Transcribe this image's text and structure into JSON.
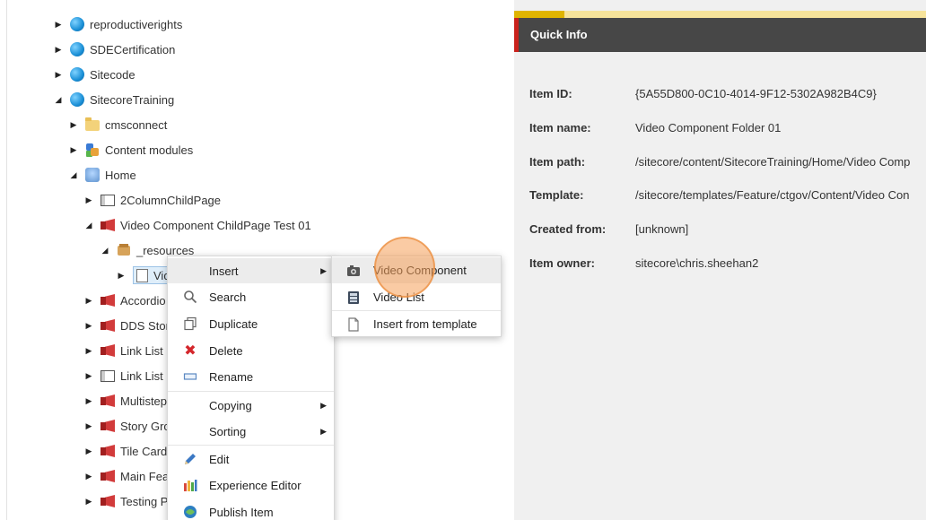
{
  "tree": {
    "items": [
      {
        "label": "reproductiverights",
        "icon": "globe-icon"
      },
      {
        "label": "SDECertification",
        "icon": "globe-icon"
      },
      {
        "label": "Sitecode",
        "icon": "globe-icon"
      },
      {
        "label": "SitecoreTraining",
        "icon": "globe-icon"
      },
      {
        "label": "cmsconnect",
        "icon": "folder-icon"
      },
      {
        "label": "Content modules",
        "icon": "modules-icon"
      },
      {
        "label": "Home",
        "icon": "home-icon"
      },
      {
        "label": "2ColumnChildPage",
        "icon": "page-icon"
      },
      {
        "label": "Video Component ChildPage Test 01",
        "icon": "red-flag-icon"
      },
      {
        "label": "_resources",
        "icon": "box-icon"
      },
      {
        "label": "Vid",
        "icon": "document-icon"
      },
      {
        "label": "Accordio",
        "icon": "red-flag-icon"
      },
      {
        "label": "DDS Stor",
        "icon": "red-flag-icon"
      },
      {
        "label": "Link List",
        "icon": "red-flag-icon"
      },
      {
        "label": "Link List",
        "icon": "page-icon"
      },
      {
        "label": "Multistep",
        "icon": "red-flag-icon"
      },
      {
        "label": "Story Gro",
        "icon": "red-flag-icon"
      },
      {
        "label": "Tile Card",
        "icon": "red-flag-icon"
      },
      {
        "label": "Main Fea",
        "icon": "red-flag-icon"
      },
      {
        "label": "Testing P",
        "icon": "red-flag-icon"
      }
    ]
  },
  "context_menu": {
    "items": [
      {
        "label": "Insert",
        "icon": "",
        "submenu": true
      },
      {
        "label": "Search",
        "icon": "search-icon",
        "submenu": false
      },
      {
        "label": "Duplicate",
        "icon": "duplicate-icon",
        "submenu": false
      },
      {
        "label": "Delete",
        "icon": "delete-icon",
        "submenu": false
      },
      {
        "label": "Rename",
        "icon": "rename-icon",
        "submenu": false
      },
      {
        "label": "Copying",
        "icon": "",
        "submenu": true
      },
      {
        "label": "Sorting",
        "icon": "",
        "submenu": true
      },
      {
        "label": "Edit",
        "icon": "pencil-icon",
        "submenu": false
      },
      {
        "label": "Experience Editor",
        "icon": "experience-editor-icon",
        "submenu": false
      },
      {
        "label": "Publish Item",
        "icon": "publish-icon",
        "submenu": false
      }
    ]
  },
  "insert_submenu": {
    "items": [
      {
        "label": "Video Component",
        "icon": "video-camera-icon"
      },
      {
        "label": "Video List",
        "icon": "video-list-icon"
      },
      {
        "label": "Insert from template",
        "icon": "document-icon"
      }
    ]
  },
  "quick_info": {
    "title": "Quick Info",
    "rows": [
      {
        "label": "Item ID:",
        "value": "{5A55D800-0C10-4014-9F12-5302A982B4C9}"
      },
      {
        "label": "Item name:",
        "value": "Video Component Folder 01"
      },
      {
        "label": "Item path:",
        "value": "/sitecore/content/SitecoreTraining/Home/Video Comp"
      },
      {
        "label": "Template:",
        "value": "/sitecore/templates/Feature/ctgov/Content/Video Con"
      },
      {
        "label": "Created from:",
        "value": "[unknown]"
      },
      {
        "label": "Item owner:",
        "value": "sitecore\\chris.sheehan2"
      }
    ]
  },
  "colors": {
    "header_bg": "#474747",
    "header_accent": "#c9221c",
    "top_accent": "#f6e39a",
    "selection": "#dfeefa",
    "click_indicator": "#f5a05a"
  }
}
